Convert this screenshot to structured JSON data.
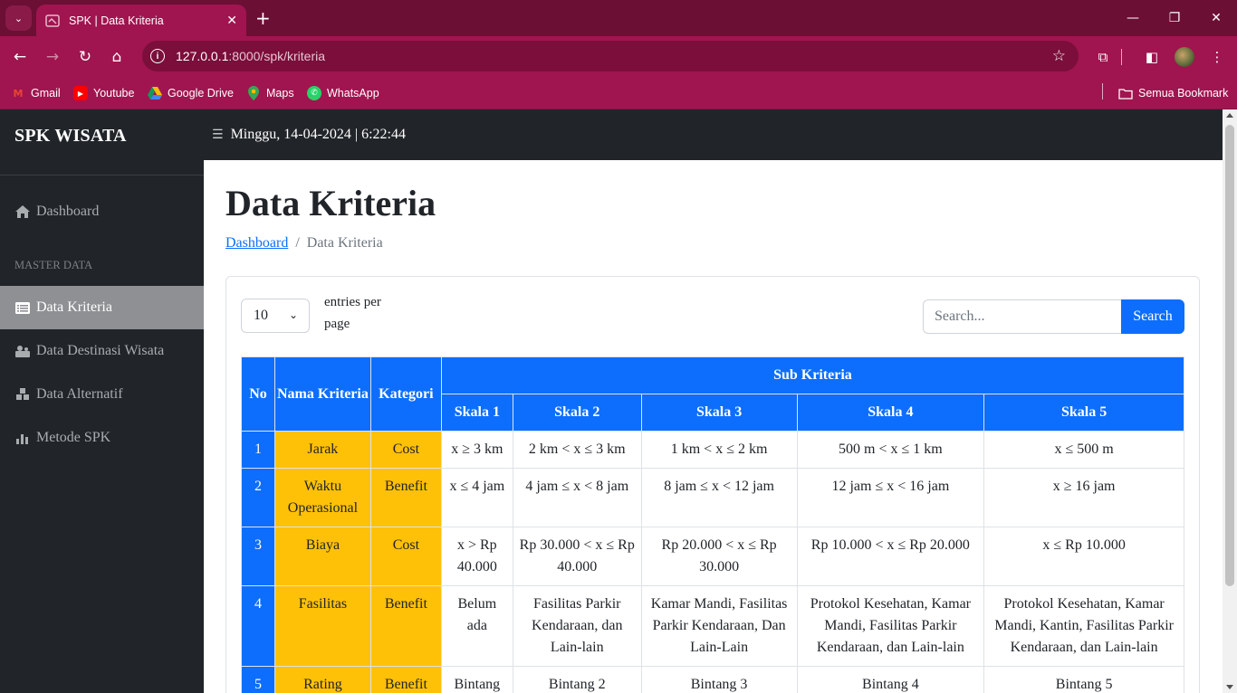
{
  "browser": {
    "tab_title": "SPK | Data Kriteria",
    "url_host": "127.0.0.1",
    "url_path": ":8000/spk/kriteria",
    "bookmarks": [
      "Gmail",
      "Youtube",
      "Google Drive",
      "Maps",
      "WhatsApp"
    ],
    "all_bookmarks": "Semua Bookmark"
  },
  "sidebar": {
    "brand": "SPK WISATA",
    "dashboard": "Dashboard",
    "section": "MASTER DATA",
    "items": [
      "Data Kriteria",
      "Data Destinasi Wisata",
      "Data Alternatif",
      "Metode SPK"
    ],
    "active_item": "Data Kriteria"
  },
  "topnav": {
    "datetime": "Minggu, 14-04-2024 | 6:22:44"
  },
  "main": {
    "title": "Data Kriteria",
    "breadcrumb": {
      "home": "Dashboard",
      "current": "Data Kriteria"
    },
    "entries_value": "10",
    "entries_label": "entries per page",
    "search_placeholder": "Search...",
    "search_button": "Search"
  },
  "table": {
    "headers": {
      "no": "No",
      "nama": "Nama Kriteria",
      "kategori": "Kategori",
      "sub": "Sub Kriteria",
      "skala": [
        "Skala 1",
        "Skala 2",
        "Skala 3",
        "Skala 4",
        "Skala 5"
      ]
    },
    "rows": [
      {
        "no": "1",
        "nama": "Jarak",
        "kategori": "Cost",
        "skala": [
          "x ≥ 3 km",
          "2 km < x ≤ 3 km",
          "1 km < x ≤ 2 km",
          "500 m < x ≤ 1 km",
          "x ≤ 500 m"
        ]
      },
      {
        "no": "2",
        "nama": "Waktu Operasional",
        "kategori": "Benefit",
        "skala": [
          "x ≤ 4 jam",
          "4 jam ≤ x < 8 jam",
          "8 jam ≤ x < 12 jam",
          "12 jam ≤ x < 16 jam",
          "x ≥ 16 jam"
        ]
      },
      {
        "no": "3",
        "nama": "Biaya",
        "kategori": "Cost",
        "skala": [
          "x > Rp 40.000",
          "Rp 30.000 < x ≤ Rp 40.000",
          "Rp 20.000 < x ≤ Rp 30.000",
          "Rp 10.000 < x ≤ Rp 20.000",
          "x ≤ Rp 10.000"
        ]
      },
      {
        "no": "4",
        "nama": "Fasilitas",
        "kategori": "Benefit",
        "skala": [
          "Belum ada",
          "Fasilitas Parkir Kendaraan, dan Lain-lain",
          "Kamar Mandi, Fasilitas Parkir Kendaraan, Dan Lain-Lain",
          "Protokol Kesehatan, Kamar Mandi, Fasilitas Parkir Kendaraan, dan Lain-lain",
          "Protokol Kesehatan, Kamar Mandi, Kantin, Fasilitas Parkir Kendaraan, dan Lain-lain"
        ]
      },
      {
        "no": "5",
        "nama": "Rating",
        "kategori": "Benefit",
        "skala": [
          "Bintang",
          "Bintang 2",
          "Bintang 3",
          "Bintang 4",
          "Bintang 5"
        ]
      }
    ]
  },
  "colors": {
    "chrome_dark": "#6b0f35",
    "chrome": "#a0154f",
    "sidebar": "#212529",
    "primary": "#0d6efd",
    "highlight": "#ffc107"
  },
  "icons": {
    "dashboard": "home-icon",
    "data_kriteria": "list-icon",
    "data_destinasi": "map-icon",
    "data_alternatif": "cubes-icon",
    "metode_spk": "chart-icon"
  }
}
